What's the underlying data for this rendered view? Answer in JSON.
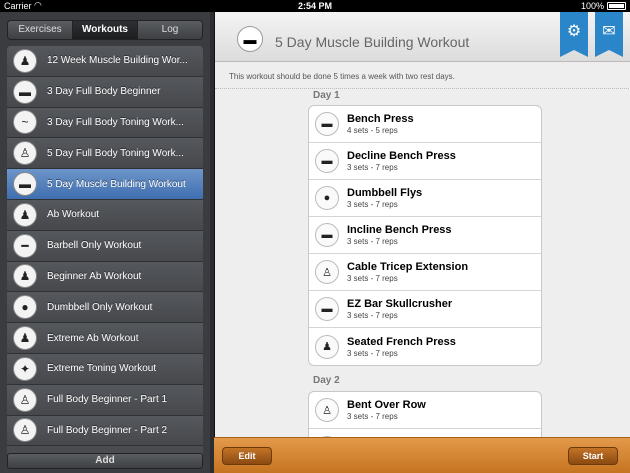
{
  "status_bar": {
    "carrier": "Carrier",
    "time": "2:54 PM",
    "battery": "100%"
  },
  "sidebar": {
    "tabs": [
      {
        "label": "Exercises",
        "active": false
      },
      {
        "label": "Workouts",
        "active": true
      },
      {
        "label": "Log",
        "active": false
      }
    ],
    "items": [
      {
        "label": "12 Week Muscle Building Wor...",
        "icon": "person-icon"
      },
      {
        "label": "3 Day Full Body Beginner",
        "icon": "bench-icon"
      },
      {
        "label": "3 Day Full Body Toning Work...",
        "icon": "lying-icon"
      },
      {
        "label": "5 Day Full Body Toning Work...",
        "icon": "standing-icon"
      },
      {
        "label": "5 Day Muscle Building Workout",
        "icon": "bench-icon",
        "selected": true
      },
      {
        "label": "Ab Workout",
        "icon": "ab-icon"
      },
      {
        "label": "Barbell Only Workout",
        "icon": "barbell-icon"
      },
      {
        "label": "Beginner Ab Workout",
        "icon": "ab-icon"
      },
      {
        "label": "Dumbbell Only Workout",
        "icon": "dumbbell-icon"
      },
      {
        "label": "Extreme Ab Workout",
        "icon": "ab-icon"
      },
      {
        "label": "Extreme Toning Workout",
        "icon": "runner-icon"
      },
      {
        "label": "Full Body Beginner - Part 1",
        "icon": "person-icon"
      },
      {
        "label": "Full Body Beginner - Part 2",
        "icon": "person-icon"
      }
    ],
    "add_label": "Add"
  },
  "main": {
    "title": "5 Day Muscle Building Workout",
    "description": "This workout should be done 5 times a week with two rest days.",
    "days": [
      {
        "label": "Day 1",
        "exercises": [
          {
            "name": "Bench Press",
            "sets": "4 sets - 5 reps"
          },
          {
            "name": "Decline Bench Press",
            "sets": "3 sets - 7 reps"
          },
          {
            "name": "Dumbbell Flys",
            "sets": "3 sets - 7 reps"
          },
          {
            "name": "Incline Bench Press",
            "sets": "3 sets - 7 reps"
          },
          {
            "name": "Cable Tricep Extension",
            "sets": "3 sets - 7 reps"
          },
          {
            "name": "EZ Bar Skullcrusher",
            "sets": "3 sets - 7 reps"
          },
          {
            "name": "Seated French Press",
            "sets": "3 sets - 7 reps"
          }
        ]
      },
      {
        "label": "Day 2",
        "exercises": [
          {
            "name": "Bent Over Row",
            "sets": "3 sets - 7 reps"
          },
          {
            "name": "",
            "sets": ""
          }
        ]
      }
    ]
  },
  "toolbar": {
    "edit_label": "Edit",
    "start_label": "Start"
  },
  "colors": {
    "accent_blue": "#2a86c8",
    "selection_blue": "#3f6fb0",
    "toolbar_orange": "#d9852f"
  }
}
